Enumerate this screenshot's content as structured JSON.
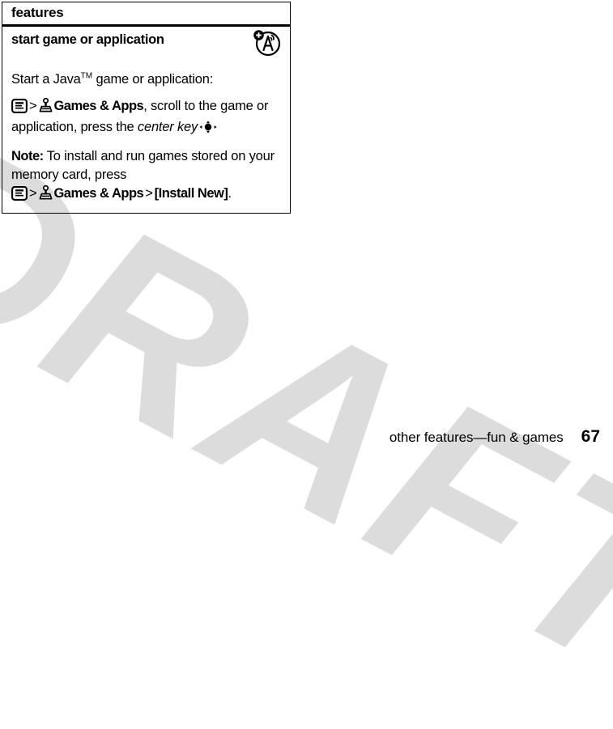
{
  "page": {
    "watermark_text": "DRAFT",
    "watermark_color": "#dcdcdc"
  },
  "features_box": {
    "header_label": "features",
    "section_title": "start game or application",
    "ota_icon_name": "over-the-air-download-icon",
    "intro": {
      "before_tm": "Start a Java",
      "tm": "TM",
      "after_tm": " game or application:"
    },
    "step_1": {
      "menu_icon": "menu-key-icon",
      "separator_1": ">",
      "games_icon": "games-and-apps-icon",
      "menu_item": "Games & Apps",
      "text_after": ", scroll to the game or application, press the ",
      "emphasis": "center key",
      "center_key_icon": "center-key-icon"
    },
    "note": {
      "label": "Note:",
      "text_1": " To install and run games stored on your memory card, press",
      "menu_icon": "menu-key-icon",
      "separator_1": ">",
      "games_icon": "games-and-apps-icon",
      "menu_item": "Games & Apps",
      "separator_2": ">",
      "install_item": "[Install New]",
      "period": "."
    }
  },
  "footer": {
    "title": "other features—fun & games",
    "page_number": "67"
  }
}
